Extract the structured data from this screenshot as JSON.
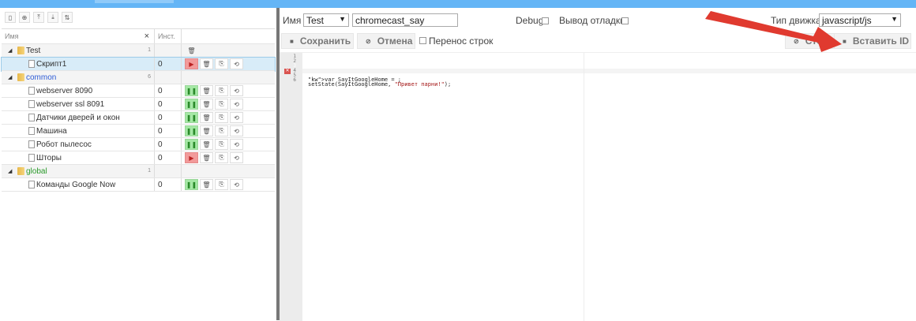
{
  "colors": {
    "topbar": "#64b5f6",
    "run": "#a5e8a5",
    "stop": "#f29a9a",
    "arrow": "#e03a2f"
  },
  "left_panel": {
    "toolbar_icons": [
      "new-file-icon",
      "add-icon",
      "upload-icon",
      "download-icon",
      "sort-icon"
    ],
    "columns": {
      "name_placeholder": "Имя",
      "clear": "×",
      "instance": "Инст."
    },
    "groups": [
      {
        "name": "Test",
        "count": "1",
        "color": "default",
        "scripts": [
          {
            "name": "Скрипт1",
            "instance": "0",
            "running": false,
            "selected": true
          }
        ]
      },
      {
        "name": "common",
        "count": "6",
        "color": "blue",
        "scripts": [
          {
            "name": "webserver 8090",
            "instance": "0",
            "running": true
          },
          {
            "name": "webserver ssl 8091",
            "instance": "0",
            "running": true
          },
          {
            "name": "Датчики дверей и окон",
            "instance": "0",
            "running": true
          },
          {
            "name": "Машина",
            "instance": "0",
            "running": true
          },
          {
            "name": "Робот пылесос",
            "instance": "0",
            "running": true
          },
          {
            "name": "Шторы",
            "instance": "0",
            "running": false
          }
        ]
      },
      {
        "name": "global",
        "count": "1",
        "color": "green",
        "scripts": [
          {
            "name": "Команды Google Now",
            "instance": "0",
            "running": true
          }
        ]
      }
    ]
  },
  "right_panel": {
    "name_label": "Имя",
    "group_select": "Test",
    "script_name": "chromecast_say",
    "debug_label": "Debug",
    "verbose_label": "Вывод отладки",
    "engine_label": "Тип движка",
    "engine_value": "javascript/js",
    "save_label": "Сохранить",
    "cancel_label": "Отмена",
    "wrap_label": "Перенос строк",
    "stop_label": "Стоп",
    "insert_id_label": "Вставить ID",
    "line_numbers": [
      "1",
      "2",
      "3",
      "4",
      "5",
      "6"
    ],
    "code": [
      "",
      "",
      "var SayItGoogleHome = ;",
      "setState(SayItGoogleHome, \"Привет парни!\");",
      "",
      ""
    ],
    "error_line": "3"
  }
}
